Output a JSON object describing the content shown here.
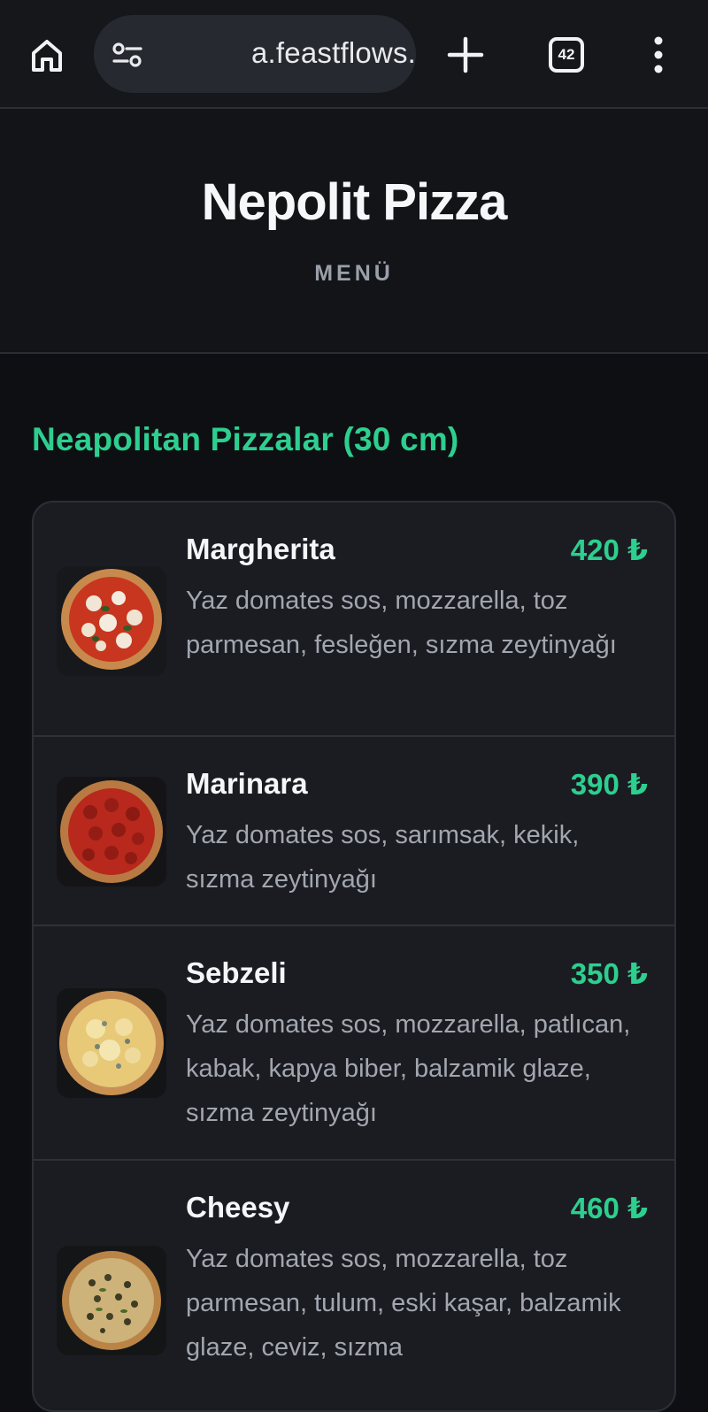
{
  "browser": {
    "url": "a.feastflows.com",
    "tab_count": "42"
  },
  "header": {
    "title": "Nepolit Pizza",
    "subtitle": "MENÜ"
  },
  "section": {
    "title": "Neapolitan Pizzalar (30 cm)"
  },
  "items": [
    {
      "name": "Margherita",
      "price": "420 ₺",
      "description": "Yaz domates sos, mozzarella, toz parmesan, fesleğen, sızma zeytinyağı"
    },
    {
      "name": "Marinara",
      "price": "390 ₺",
      "description": "Yaz domates sos, sarımsak, kekik, sızma zeytinyağı"
    },
    {
      "name": "Sebzeli",
      "price": "350 ₺",
      "description": "Yaz domates sos, mozzarella, patlıcan, kabak, kapya biber, balzamik glaze, sızma zeytinyağı"
    },
    {
      "name": "Cheesy",
      "price": "460 ₺",
      "description": "Yaz domates sos, mozzarella, toz parmesan, tulum, eski kaşar, balzamik glaze, ceviz, sızma"
    }
  ],
  "colors": {
    "accent": "#2dcf8f",
    "background": "#0d0f13",
    "card": "#1a1c22"
  },
  "icons": [
    "home-icon",
    "site-settings-icon",
    "plus-icon",
    "tab-switcher-icon",
    "more-vert-icon"
  ]
}
